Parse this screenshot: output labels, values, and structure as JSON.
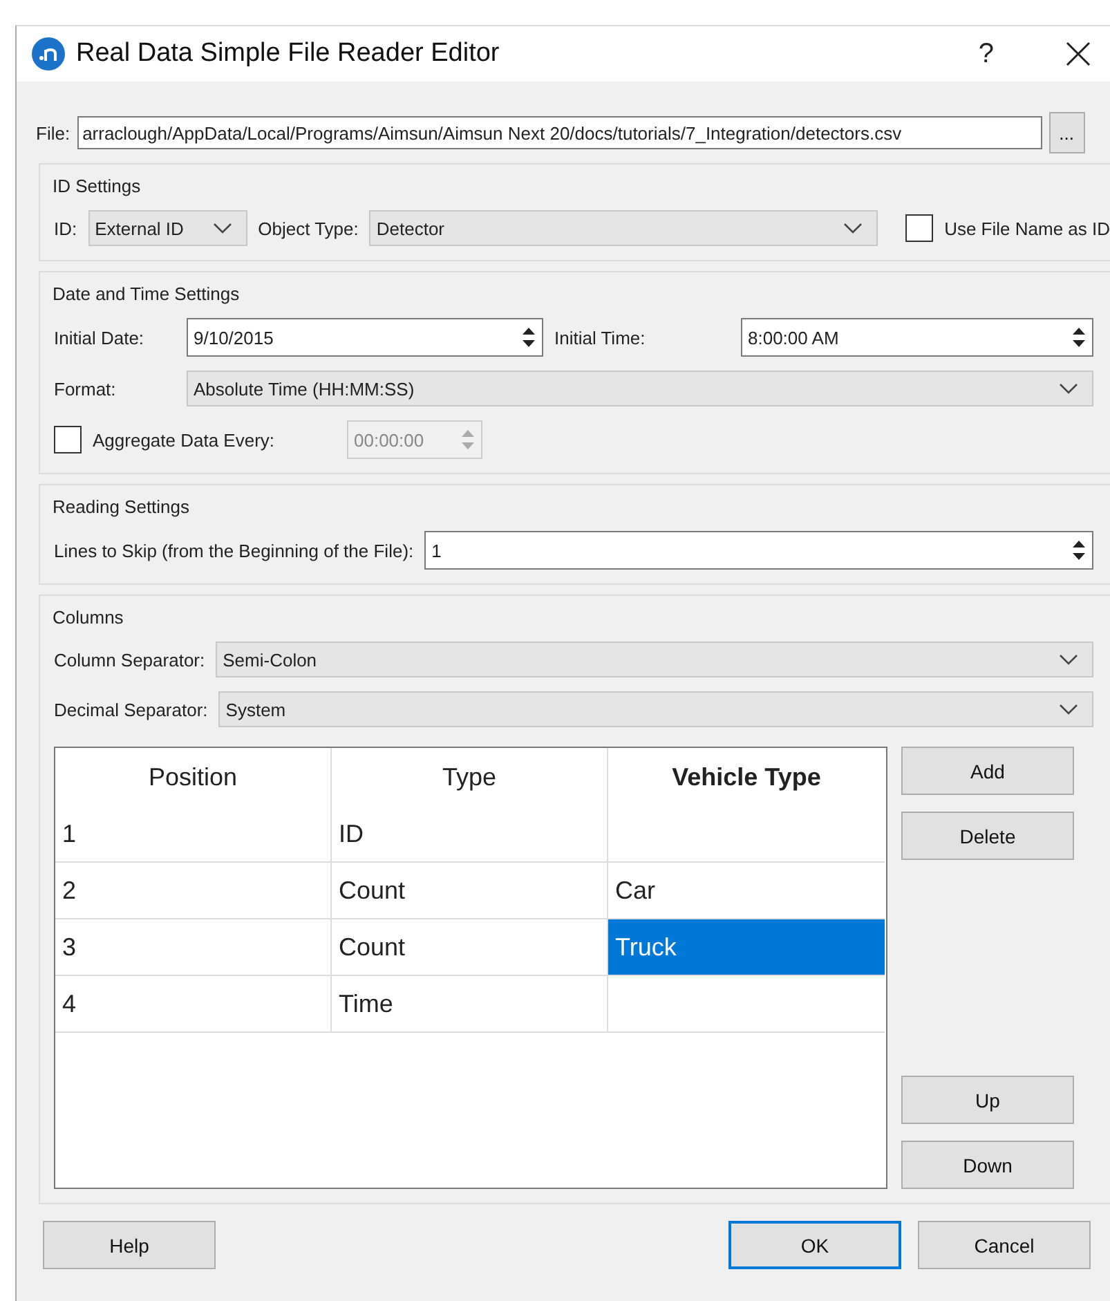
{
  "window": {
    "title": "Real Data Simple File Reader Editor",
    "help_glyph": "?"
  },
  "file": {
    "label": "File:",
    "value": "arraclough/AppData/Local/Programs/Aimsun/Aimsun Next 20/docs/tutorials/7_Integration/detectors.csv",
    "browse": "..."
  },
  "id_settings": {
    "title": "ID Settings",
    "id_label": "ID:",
    "id_value": "External ID",
    "object_type_label": "Object Type:",
    "object_type_value": "Detector",
    "use_file_name": {
      "label": "Use File Name as ID",
      "checked": false
    }
  },
  "date_time_settings": {
    "title": "Date and Time Settings",
    "initial_date_label": "Initial Date:",
    "initial_date": "9/10/2015",
    "initial_time_label": "Initial Time:",
    "initial_time": "8:00:00 AM",
    "format_label": "Format:",
    "format_value": "Absolute Time (HH:MM:SS)",
    "aggregate": {
      "label": "Aggregate Data Every:",
      "checked": false,
      "value": "00:00:00",
      "disabled": true
    }
  },
  "reading_settings": {
    "title": "Reading Settings",
    "lines_to_skip_label": "Lines to Skip (from the Beginning of the File):",
    "lines_to_skip": "1"
  },
  "columns": {
    "title": "Columns",
    "column_separator_label": "Column Separator:",
    "column_separator": "Semi-Colon",
    "decimal_separator_label": "Decimal Separator:",
    "decimal_separator": "System",
    "table": {
      "columns": [
        {
          "label": "Position",
          "bold": false
        },
        {
          "label": "Type",
          "bold": false
        },
        {
          "label": "Vehicle Type",
          "bold": true
        }
      ],
      "rows": [
        {
          "cells": [
            {
              "text": "1",
              "selected": false
            },
            {
              "text": "ID",
              "selected": false
            },
            {
              "text": "",
              "selected": false
            }
          ]
        },
        {
          "cells": [
            {
              "text": "2",
              "selected": false
            },
            {
              "text": "Count",
              "selected": false
            },
            {
              "text": "Car",
              "selected": false
            }
          ]
        },
        {
          "cells": [
            {
              "text": "3",
              "selected": false
            },
            {
              "text": "Count",
              "selected": false
            },
            {
              "text": "Truck",
              "selected": true
            }
          ]
        },
        {
          "cells": [
            {
              "text": "4",
              "selected": false
            },
            {
              "text": "Time",
              "selected": false
            },
            {
              "text": "",
              "selected": false
            }
          ]
        }
      ]
    },
    "side_buttons_top": [
      "Add",
      "Delete"
    ],
    "side_buttons_bottom": [
      "Up",
      "Down"
    ]
  },
  "footer": {
    "help": "Help",
    "ok": "OK",
    "cancel": "Cancel"
  }
}
